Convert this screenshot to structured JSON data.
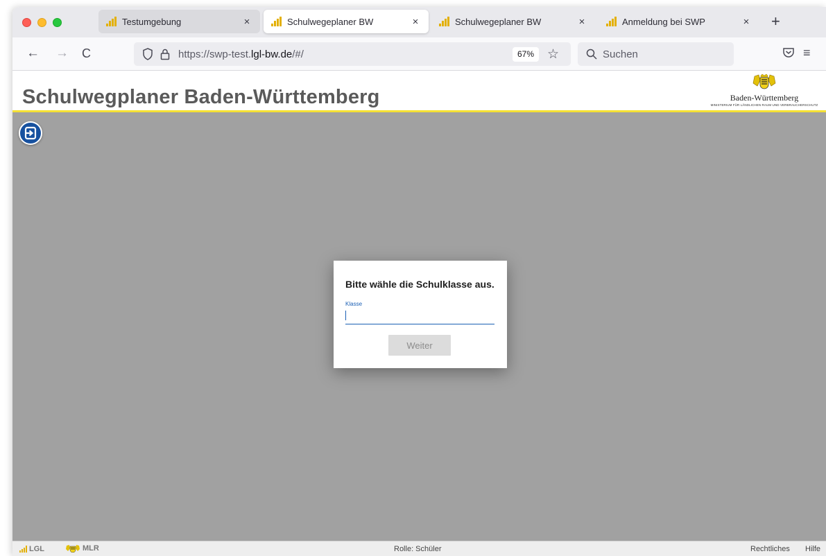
{
  "browser": {
    "tabs": [
      {
        "label": "Testumgebung",
        "close": "×"
      },
      {
        "label": "Schulwegeplaner BW",
        "close": "×"
      },
      {
        "label": "Schulwegeplaner BW",
        "close": "×"
      },
      {
        "label": "Anmeldung bei SWP",
        "close": "×"
      }
    ],
    "new_tab": "+",
    "url_prefix": "https://swp-test.",
    "url_domain": "lgl-bw.de",
    "url_suffix": "/#/",
    "zoom": "67%",
    "search_placeholder": "Suchen",
    "back": "←",
    "forward": "→",
    "reload": "C",
    "star": "☆",
    "menu": "≡"
  },
  "app": {
    "title": "Schulwegplaner Baden-Württemberg",
    "logo_name": "Baden-Württemberg",
    "logo_sub": "MINISTERIUM FÜR LÄNDLICHEN RAUM UND VERBRAUCHERSCHUTZ"
  },
  "dialog": {
    "title": "Bitte wähle die Schulklasse aus.",
    "field_label": "Klasse",
    "field_value": "",
    "button": "Weiter"
  },
  "footer": {
    "lgl": "LGL",
    "mlr": "MLR",
    "role": "Rolle: Schüler",
    "legal": "Rechtliches",
    "help": "Hilfe"
  },
  "colors": {
    "accent_blue": "#17519f",
    "field_blue": "#1a5fb4",
    "header_yellow": "#f5e134",
    "page_gray": "#a1a1a1"
  }
}
